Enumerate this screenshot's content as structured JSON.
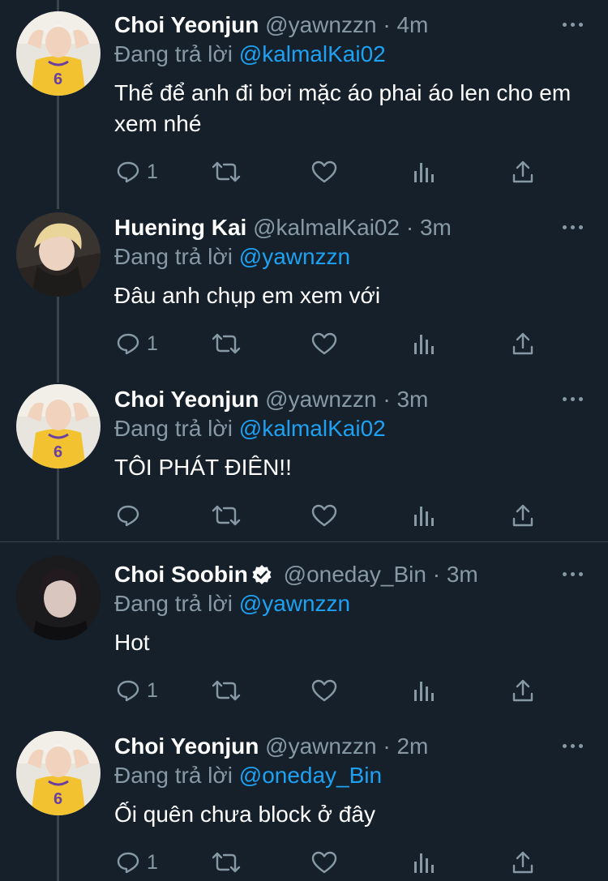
{
  "reply_prefix": "Đang trả lời",
  "tweets": [
    {
      "name": "Choi Yeonjun",
      "handle": "@yawnzzn",
      "dot": "·",
      "time": "4m",
      "reply_to": "@kalmalKai02",
      "text": "Thế để anh đi bơi mặc áo phai áo len cho em xem nhé",
      "reply_count": "1",
      "avatar": "yellow-jersey"
    },
    {
      "name": "Huening Kai",
      "handle": "@kalmalKai02",
      "dot": "·",
      "time": "3m",
      "reply_to": "@yawnzzn",
      "text": "Đâu anh chụp em xem với",
      "reply_count": "1",
      "avatar": "blond"
    },
    {
      "name": "Choi Yeonjun",
      "handle": "@yawnzzn",
      "dot": "·",
      "time": "3m",
      "reply_to": "@kalmalKai02",
      "text": "TÔI PHÁT ĐIÊN!!",
      "reply_count": "",
      "avatar": "yellow-jersey"
    },
    {
      "name": "Choi Soobin",
      "handle": "@oneday_Bin",
      "dot": "·",
      "time": "3m",
      "reply_to": "@yawnzzn",
      "text": "Hot",
      "reply_count": "1",
      "avatar": "dark",
      "verified": true
    },
    {
      "name": "Choi Yeonjun",
      "handle": "@yawnzzn",
      "dot": "·",
      "time": "2m",
      "reply_to": "@oneday_Bin",
      "text": "Ối quên chưa block ở đây",
      "reply_count": "1",
      "avatar": "yellow-jersey"
    }
  ],
  "colors": {
    "background": "#15202b",
    "muted": "#8899a6",
    "mention": "#1da1f2",
    "divider": "#38444d"
  },
  "icons": [
    "reply-icon",
    "retweet-icon",
    "like-icon",
    "analytics-icon",
    "share-icon",
    "more-icon",
    "verified-icon"
  ]
}
